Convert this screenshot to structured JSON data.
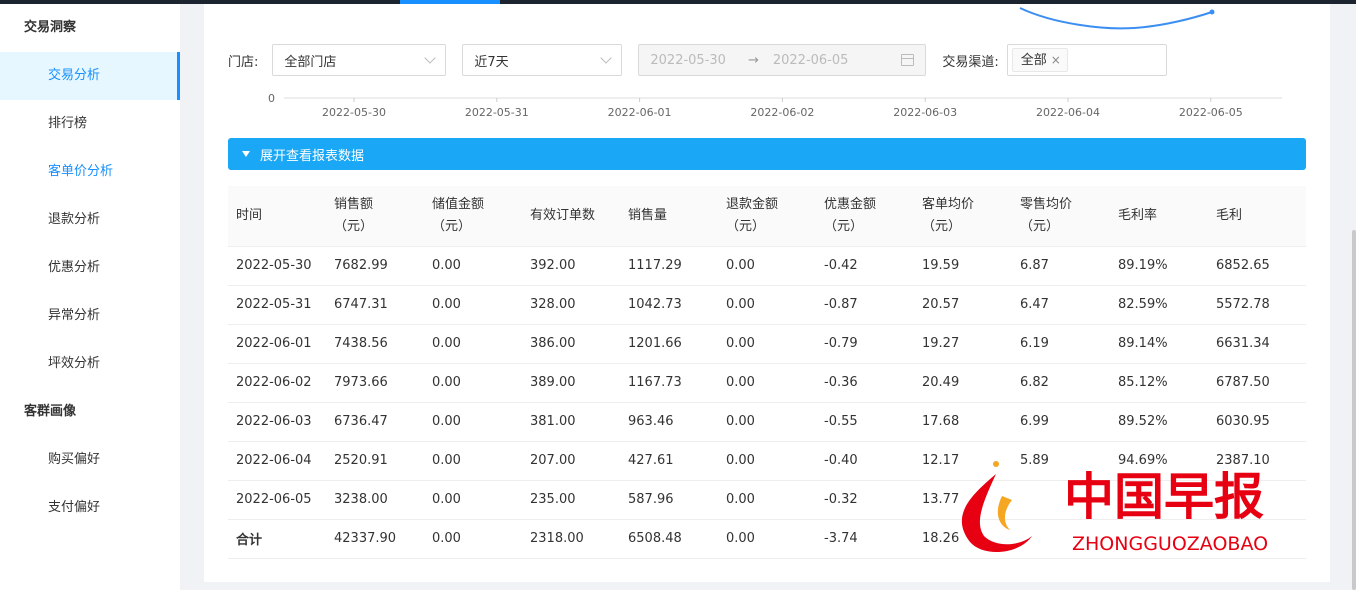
{
  "sidebar": {
    "groups": [
      {
        "title": "交易洞察",
        "items": [
          {
            "label": "交易分析",
            "state": "active"
          },
          {
            "label": "排行榜",
            "state": "normal"
          },
          {
            "label": "客单价分析",
            "state": "highlight"
          },
          {
            "label": "退款分析",
            "state": "normal"
          },
          {
            "label": "优惠分析",
            "state": "normal"
          },
          {
            "label": "异常分析",
            "state": "normal"
          },
          {
            "label": "坪效分析",
            "state": "normal"
          }
        ]
      },
      {
        "title": "客群画像",
        "items": [
          {
            "label": "购买偏好",
            "state": "normal"
          },
          {
            "label": "支付偏好",
            "state": "normal"
          }
        ]
      }
    ]
  },
  "filters": {
    "store_label": "门店:",
    "store_value": "全部门店",
    "period_value": "近7天",
    "date_start": "2022-05-30",
    "date_arrow": "→",
    "date_end": "2022-06-05",
    "channel_label": "交易渠道:",
    "channel_tag": "全部",
    "channel_tag_close": "×"
  },
  "chart_data": {
    "type": "line",
    "x": [
      "2022-05-30",
      "2022-05-31",
      "2022-06-01",
      "2022-06-02",
      "2022-06-03",
      "2022-06-04",
      "2022-06-05"
    ],
    "y_tick_labels": [
      "0"
    ],
    "title": "",
    "xlabel": "",
    "ylabel": ""
  },
  "expand_bar": {
    "label": "展开查看报表数据"
  },
  "table": {
    "headers": [
      [
        "时间"
      ],
      [
        "销售额",
        "（元）"
      ],
      [
        "储值金额",
        "（元）"
      ],
      [
        "有效订单数"
      ],
      [
        "销售量"
      ],
      [
        "退款金额",
        "（元）"
      ],
      [
        "优惠金额",
        "（元）"
      ],
      [
        "客单均价",
        "（元）"
      ],
      [
        "零售均价",
        "（元）"
      ],
      [
        "毛利率"
      ],
      [
        "毛利"
      ]
    ],
    "rows": [
      [
        "2022-05-30",
        "7682.99",
        "0.00",
        "392.00",
        "1117.29",
        "0.00",
        "-0.42",
        "19.59",
        "6.87",
        "89.19%",
        "6852.65"
      ],
      [
        "2022-05-31",
        "6747.31",
        "0.00",
        "328.00",
        "1042.73",
        "0.00",
        "-0.87",
        "20.57",
        "6.47",
        "82.59%",
        "5572.78"
      ],
      [
        "2022-06-01",
        "7438.56",
        "0.00",
        "386.00",
        "1201.66",
        "0.00",
        "-0.79",
        "19.27",
        "6.19",
        "89.14%",
        "6631.34"
      ],
      [
        "2022-06-02",
        "7973.66",
        "0.00",
        "389.00",
        "1167.73",
        "0.00",
        "-0.36",
        "20.49",
        "6.82",
        "85.12%",
        "6787.50"
      ],
      [
        "2022-06-03",
        "6736.47",
        "0.00",
        "381.00",
        "963.46",
        "0.00",
        "-0.55",
        "17.68",
        "6.99",
        "89.52%",
        "6030.95"
      ],
      [
        "2022-06-04",
        "2520.91",
        "0.00",
        "207.00",
        "427.61",
        "0.00",
        "-0.40",
        "12.17",
        "5.89",
        "94.69%",
        "2387.10"
      ],
      [
        "2022-06-05",
        "3238.00",
        "0.00",
        "235.00",
        "587.96",
        "0.00",
        "-0.32",
        "13.77",
        "",
        "",
        ""
      ]
    ],
    "total": [
      "合计",
      "42337.90",
      "0.00",
      "2318.00",
      "6508.48",
      "0.00",
      "-3.74",
      "18.26",
      "",
      "",
      ""
    ]
  },
  "watermark": {
    "text_cn": "中国早报",
    "text_en": "ZHONGGUOZAOBAO"
  },
  "colors": {
    "accent": "#1890ff",
    "expand_bar": "#1aa7f5",
    "watermark_red": "#e60012"
  }
}
